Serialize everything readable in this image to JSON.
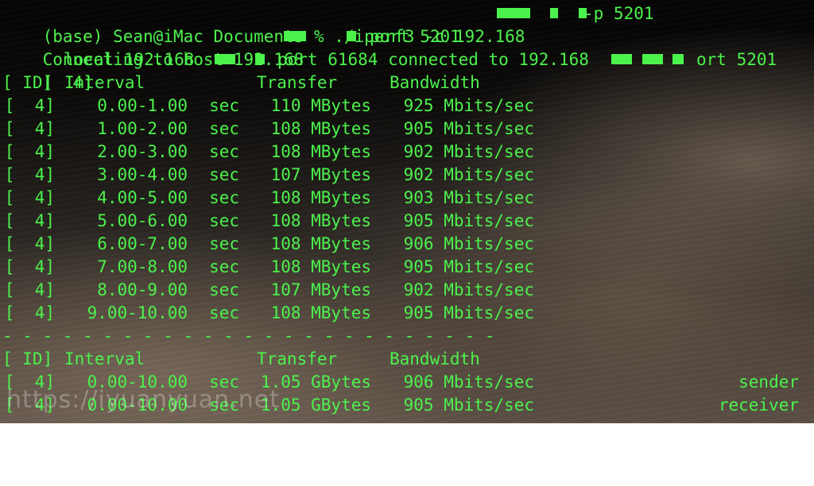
{
  "prompt": {
    "text": "(base) Sean@iMac Documents % ./iperf3 -c 192.168",
    "args": "-p 5201"
  },
  "connecting": {
    "prefix": "Connecting to host 192.168",
    "port": "port 5201"
  },
  "local_line": {
    "id": "[  4]",
    "local": "local 192.168",
    "port": "port 61684 connected to 192.168",
    "suffix": "ort 5201"
  },
  "header": {
    "id": "[ ID]",
    "interval": "Interval",
    "transfer": "Transfer",
    "bandwidth": "Bandwidth"
  },
  "rows": [
    {
      "id": "[  4]",
      "interval": "0.00-1.00",
      "unit": "sec",
      "transfer": "110 MBytes",
      "bandwidth": "925 Mbits/sec"
    },
    {
      "id": "[  4]",
      "interval": "1.00-2.00",
      "unit": "sec",
      "transfer": "108 MBytes",
      "bandwidth": "905 Mbits/sec"
    },
    {
      "id": "[  4]",
      "interval": "2.00-3.00",
      "unit": "sec",
      "transfer": "108 MBytes",
      "bandwidth": "902 Mbits/sec"
    },
    {
      "id": "[  4]",
      "interval": "3.00-4.00",
      "unit": "sec",
      "transfer": "107 MBytes",
      "bandwidth": "902 Mbits/sec"
    },
    {
      "id": "[  4]",
      "interval": "4.00-5.00",
      "unit": "sec",
      "transfer": "108 MBytes",
      "bandwidth": "903 Mbits/sec"
    },
    {
      "id": "[  4]",
      "interval": "5.00-6.00",
      "unit": "sec",
      "transfer": "108 MBytes",
      "bandwidth": "905 Mbits/sec"
    },
    {
      "id": "[  4]",
      "interval": "6.00-7.00",
      "unit": "sec",
      "transfer": "108 MBytes",
      "bandwidth": "906 Mbits/sec"
    },
    {
      "id": "[  4]",
      "interval": "7.00-8.00",
      "unit": "sec",
      "transfer": "108 MBytes",
      "bandwidth": "905 Mbits/sec"
    },
    {
      "id": "[  4]",
      "interval": "8.00-9.00",
      "unit": "sec",
      "transfer": "107 MBytes",
      "bandwidth": "902 Mbits/sec"
    },
    {
      "id": "[  4]",
      "interval": "9.00-10.00",
      "unit": "sec",
      "transfer": "108 MBytes",
      "bandwidth": "905 Mbits/sec"
    }
  ],
  "separator": "- - - - - - - - - - - - - - - - - - - - - - - - -",
  "summary_header": {
    "id": "[ ID]",
    "interval": "Interval",
    "transfer": "Transfer",
    "bandwidth": "Bandwidth"
  },
  "summary": [
    {
      "id": "[  4]",
      "interval": "0.00-10.00",
      "unit": "sec",
      "transfer": "1.05 GBytes",
      "bandwidth": "906 Mbits/sec",
      "role": "sender"
    },
    {
      "id": "[  4]",
      "interval": "0.00-10.00",
      "unit": "sec",
      "transfer": "1.05 GBytes",
      "bandwidth": "905 Mbits/sec",
      "role": "receiver"
    }
  ],
  "watermark": "https://iyuanyuan.net",
  "colors": {
    "terminal_text": "#4cf24c"
  }
}
